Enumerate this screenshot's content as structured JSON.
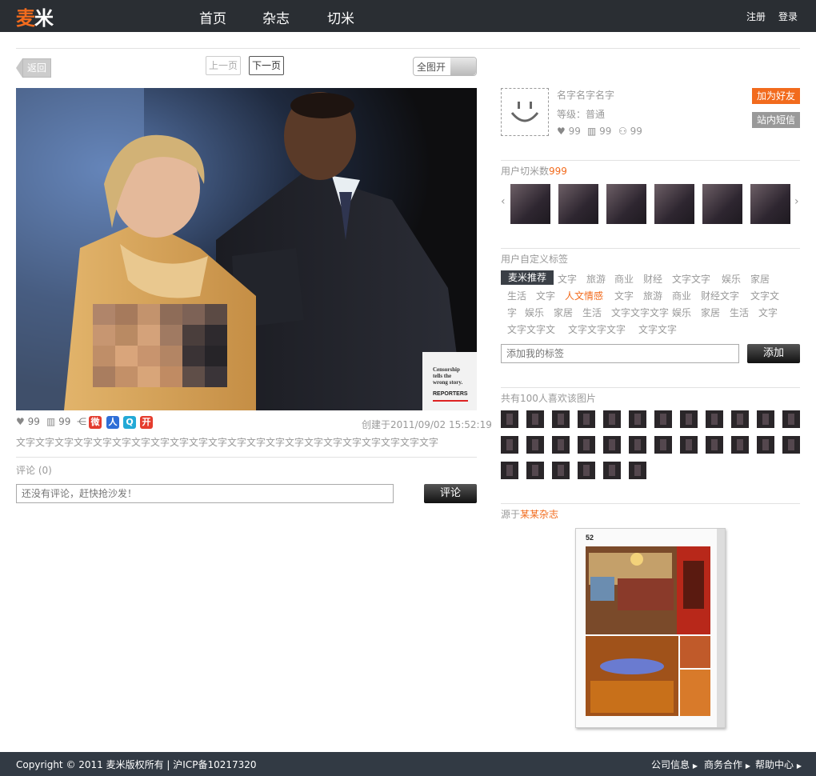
{
  "header": {
    "logo_part1": "麦",
    "logo_part2": "米",
    "nav": [
      "首页",
      "杂志",
      "切米"
    ],
    "register": "注册",
    "login": "登录"
  },
  "toolbar": {
    "back": "返回",
    "prev": "上一页",
    "next": "下一页",
    "fullscreen": "全图开"
  },
  "photo": {
    "watermark_line1": "Censorship",
    "watermark_line2": "tells the",
    "watermark_line3": "wrong story.",
    "watermark_brand": "REPORTERS"
  },
  "post": {
    "likes": "99",
    "views": "99",
    "created": "创建于2011/09/02 15:52:19",
    "description": "文字文字文字文字文字文字文字文字文字文字文字文字文字文字文字文字文字文字文字文字文字文字",
    "share_icons": [
      "weibo-icon",
      "renren-icon",
      "qq-icon",
      "kaixin-icon"
    ],
    "share_glyphs": [
      "微",
      "人",
      "Q",
      "开"
    ]
  },
  "comments": {
    "label": "评论 (0)",
    "placeholder": "还没有评论，赶快抢沙发！",
    "submit": "评论"
  },
  "user": {
    "name": "名字名字名字",
    "level": "等级：普通",
    "likes": "99",
    "views": "99",
    "friends": "99",
    "add_friend": "加为好友",
    "message": "站内短信"
  },
  "qiemi": {
    "label": "用户切米数",
    "count": "999"
  },
  "tags": {
    "title": "用户自定义标签",
    "highlight": "麦米推荐",
    "items": [
      "文字",
      "旅游",
      "商业",
      "财经",
      "文字文字",
      "娱乐",
      "家居",
      "生活",
      "文字",
      "人文情感",
      "文字",
      "旅游",
      "商业",
      "财经文字",
      "文字文",
      "字",
      "娱乐",
      "家居",
      "生活",
      "文字文字文字",
      "娱乐",
      "家居",
      "生活",
      "文字",
      "文字文字文",
      "文字文字文字",
      "文字文字"
    ],
    "active": "人文情感",
    "input_placeholder": "添加我的标签",
    "add_button": "添加"
  },
  "likers": {
    "title": "共有100人喜欢该图片"
  },
  "source": {
    "prefix": "源于",
    "magazine": "某某杂志",
    "page_no": "52"
  },
  "footer": {
    "copyright": "Copyright © 2011 麦米版权所有 | 沪ICP备10217320",
    "links": [
      "公司信息",
      "商务合作",
      "帮助中心"
    ]
  },
  "colors": {
    "accent": "#f26b1d",
    "header_bg": "#2a2e33",
    "footer_bg": "#323a44"
  }
}
